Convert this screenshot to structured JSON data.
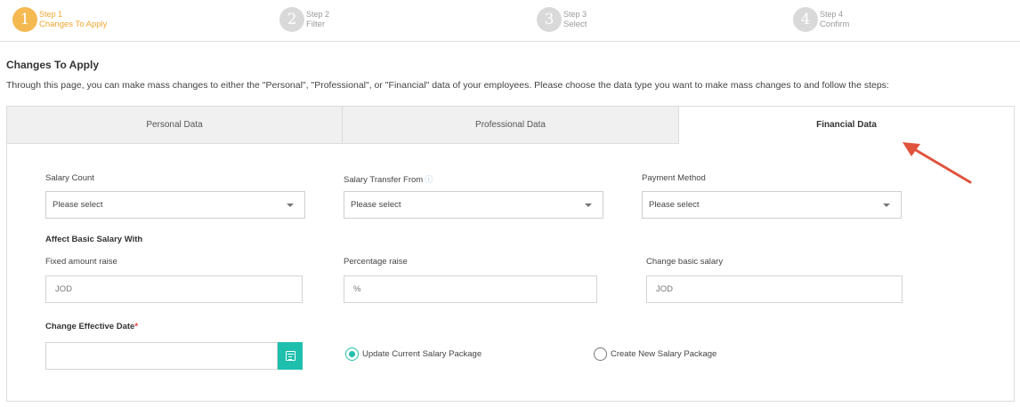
{
  "stepper": {
    "steps": [
      {
        "number": "1",
        "label": "Step 1",
        "name": "Changes To Apply",
        "active": true
      },
      {
        "number": "2",
        "label": "Step 2",
        "name": "Filter",
        "active": false
      },
      {
        "number": "3",
        "label": "Step 3",
        "name": "Select",
        "active": false
      },
      {
        "number": "4",
        "label": "Step 4",
        "name": "Confirm",
        "active": false
      }
    ]
  },
  "section": {
    "title": "Changes To Apply",
    "intro": "Through this page, you can make mass changes to either the \"Personal\", \"Professional\", or \"Financial\" data of your employees. Please choose the data type you want to make mass changes to and follow the steps:"
  },
  "tabs": {
    "personal": "Personal Data",
    "professional": "Professional Data",
    "financial": "Financial Data",
    "active": "financial"
  },
  "form": {
    "salary_count": {
      "label": "Salary Count",
      "value": "Please select"
    },
    "salary_transfer_from": {
      "label": "Salary Transfer From",
      "value": "Please select"
    },
    "payment_method": {
      "label": "Payment Method",
      "value": "Please select"
    },
    "affect_heading": "Affect Basic Salary With",
    "fixed_raise": {
      "label": "Fixed amount raise",
      "placeholder": "JOD"
    },
    "percentage_raise": {
      "label": "Percentage raise",
      "placeholder": "%"
    },
    "change_basic": {
      "label": "Change basic salary",
      "placeholder": "JOD"
    },
    "effective_date": {
      "label": "Change Effective Date",
      "required_mark": "*",
      "value": ""
    },
    "radio_update": {
      "label": "Update Current Salary Package",
      "checked": true
    },
    "radio_create": {
      "label": "Create New Salary Package",
      "checked": false
    }
  },
  "colors": {
    "accent": "#1fbfad",
    "step_active": "#f5b952",
    "step_inactive": "#d9d9d9",
    "arrow": "#e0533d",
    "required": "#e53935"
  },
  "icons": {
    "info": "info-icon",
    "calendar": "calendar-icon",
    "dropdown": "chevron-down-icon"
  }
}
